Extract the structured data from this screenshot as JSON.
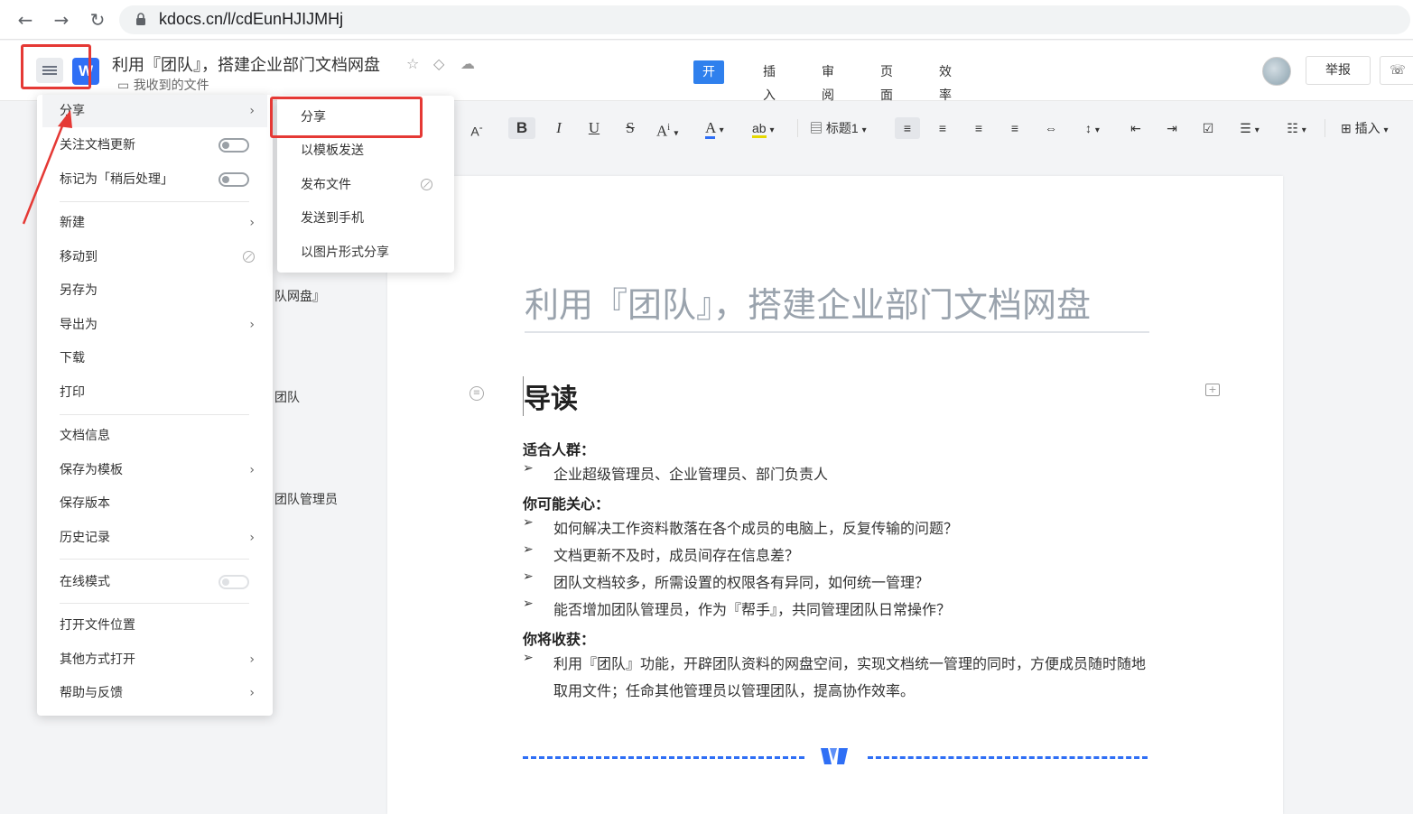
{
  "browser": {
    "back_icon": "←",
    "forward_icon": "→",
    "reload_icon": "↻",
    "url": "kdocs.cn/l/cdEunHJIJMHj"
  },
  "header": {
    "logo_text": "W",
    "title": "利用『团队』，搭建企业部门文档网盘",
    "folder": "我收到的文件",
    "tabs": [
      "开始",
      "插入",
      "审阅",
      "页面",
      "效率"
    ],
    "active_tab": "开始",
    "report_label": "举报",
    "share_icon": "☏"
  },
  "toolbar": {
    "font_size_down": "A",
    "bold": "B",
    "italic": "I",
    "underline": "U",
    "strike": "S",
    "font_style": "A",
    "font_color": "A",
    "highlight": "ab",
    "heading_label": "标题1",
    "insert_label": "插入",
    "font_color_hex": "#2f6ff5",
    "highlight_hex": "#e6d800"
  },
  "outline": {
    "items": [
      "队网盘』",
      "团队",
      "团队管理员"
    ]
  },
  "menu": {
    "items": [
      {
        "label": "分享",
        "chevron": true
      },
      {
        "label": "关注文档更新",
        "toggle": true
      },
      {
        "label": "标记为「稍后处理」",
        "toggle": true
      },
      {
        "label": "新建",
        "chevron": true
      },
      {
        "label": "移动到",
        "disabled": true
      },
      {
        "label": "另存为"
      },
      {
        "label": "导出为",
        "chevron": true
      },
      {
        "label": "下载"
      },
      {
        "label": "打印"
      },
      {
        "label": "文档信息"
      },
      {
        "label": "保存为模板",
        "chevron": true
      },
      {
        "label": "保存版本"
      },
      {
        "label": "历史记录",
        "chevron": true
      },
      {
        "label": "在线模式",
        "toggle": true
      },
      {
        "label": "打开文件位置"
      },
      {
        "label": "其他方式打开",
        "chevron": true
      },
      {
        "label": "帮助与反馈",
        "chevron": true
      }
    ]
  },
  "submenu": {
    "items": [
      "分享",
      "以模板发送",
      "发布文件",
      "发送到手机",
      "以图片形式分享"
    ]
  },
  "document": {
    "title": "利用『团队』，搭建企业部门文档网盘",
    "heading": "导读",
    "sections": [
      {
        "label": "适合人群：",
        "bullets": [
          "企业超级管理员、企业管理员、部门负责人"
        ]
      },
      {
        "label": "你可能关心：",
        "bullets": [
          "如何解决工作资料散落在各个成员的电脑上，反复传输的问题？",
          "文档更新不及时，成员间存在信息差？",
          "团队文档较多，所需设置的权限各有异同，如何统一管理？",
          "能否增加团队管理员，作为『帮手』，共同管理团队日常操作？"
        ]
      },
      {
        "label": "你将收获：",
        "bullets": [
          "利用『团队』功能，开辟团队资料的网盘空间，实现文档统一管理的同时，方便成员随时随地取用文件；任命其他管理员以管理团队，提高协作效率。"
        ]
      }
    ],
    "bullet_glyph": "➢"
  },
  "colors": {
    "accent": "#2f6ff5",
    "annotation_red": "#e53935"
  }
}
